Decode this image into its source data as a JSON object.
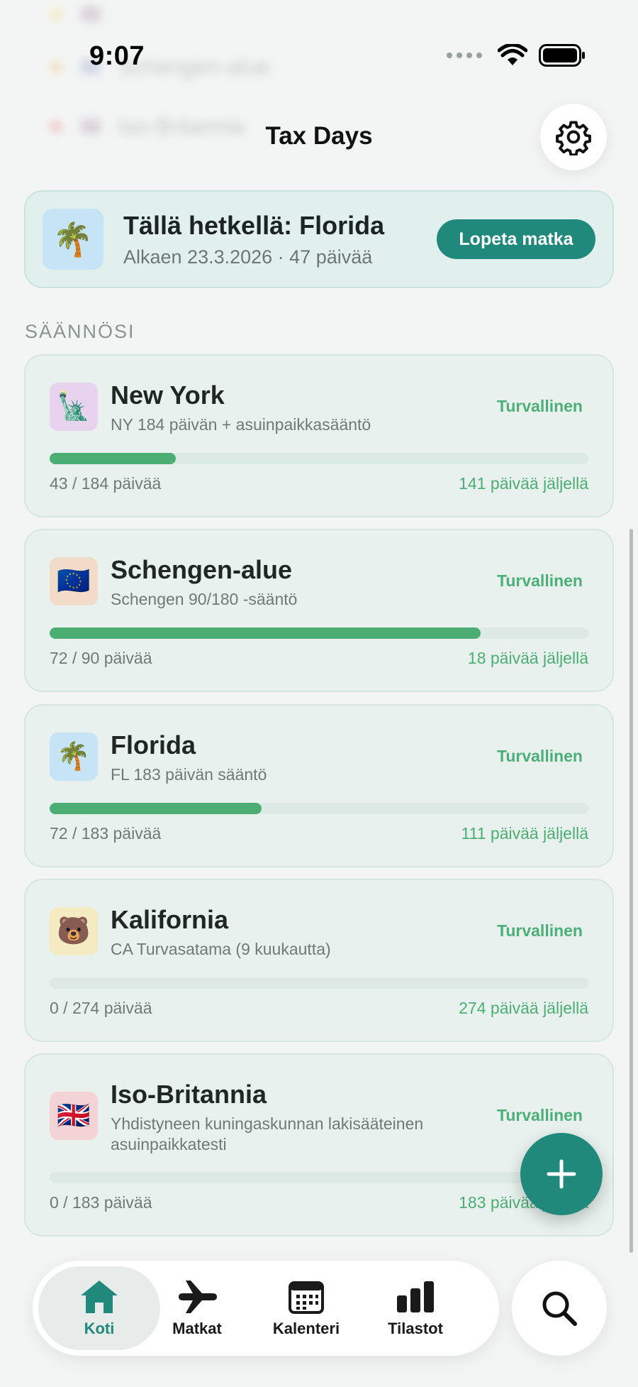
{
  "status_bar": {
    "time": "9:07"
  },
  "header": {
    "title": "Tax Days"
  },
  "current_trip": {
    "icon": "palm-tree-emoji",
    "emoji": "🌴",
    "title": "Tällä hetkellä: Florida",
    "subtitle": "Alkaen 23.3.2026 · 47 päivää",
    "end_label": "Lopeta matka"
  },
  "section_label": "SÄÄNNÖSI",
  "rules": [
    {
      "emoji": "🗽",
      "flag_bg": "#e7d3ee",
      "name": "New York",
      "desc": "NY 184 päivän + asuinpaikkasääntö",
      "badge": "Turvallinen",
      "used": "43 / 184 päivää",
      "remaining": "141 päivää jäljellä",
      "progress": 0.234
    },
    {
      "emoji": "🇪🇺",
      "flag_bg": "#f2dcc9",
      "name": "Schengen-alue",
      "desc": "Schengen 90/180 -sääntö",
      "badge": "Turvallinen",
      "used": "72 / 90 päivää",
      "remaining": "18 päivää jäljellä",
      "progress": 0.8
    },
    {
      "emoji": "🌴",
      "flag_bg": "#c6e4f6",
      "name": "Florida",
      "desc": "FL 183 päivän sääntö",
      "badge": "Turvallinen",
      "used": "72 / 183 päivää",
      "remaining": "111 päivää jäljellä",
      "progress": 0.393
    },
    {
      "emoji": "🐻",
      "flag_bg": "#f5ebc3",
      "name": "Kalifornia",
      "desc": "CA Turvasatama (9 kuukautta)",
      "badge": "Turvallinen",
      "used": "0 / 274 päivää",
      "remaining": "274 päivää jäljellä",
      "progress": 0
    },
    {
      "emoji": "🇬🇧",
      "flag_bg": "#f4d3d6",
      "name": "Iso-Britannia",
      "desc": "Yhdistyneen kuningaskunnan lakisääteinen asuinpaikkatesti",
      "badge": "Turvallinen",
      "used": "0 / 183 päivää",
      "remaining": "183 päivää jäljellä",
      "progress": 0
    }
  ],
  "tabs": [
    {
      "label": "Koti",
      "icon": "home-icon",
      "active": true
    },
    {
      "label": "Matkat",
      "icon": "airplane-icon",
      "active": false
    },
    {
      "label": "Kalenteri",
      "icon": "calendar-icon",
      "active": false
    },
    {
      "label": "Tilastot",
      "icon": "bar-chart-icon",
      "active": false
    }
  ],
  "colors": {
    "accent": "#21897c",
    "safe": "#4cae73",
    "background": "#f3f5f4"
  }
}
